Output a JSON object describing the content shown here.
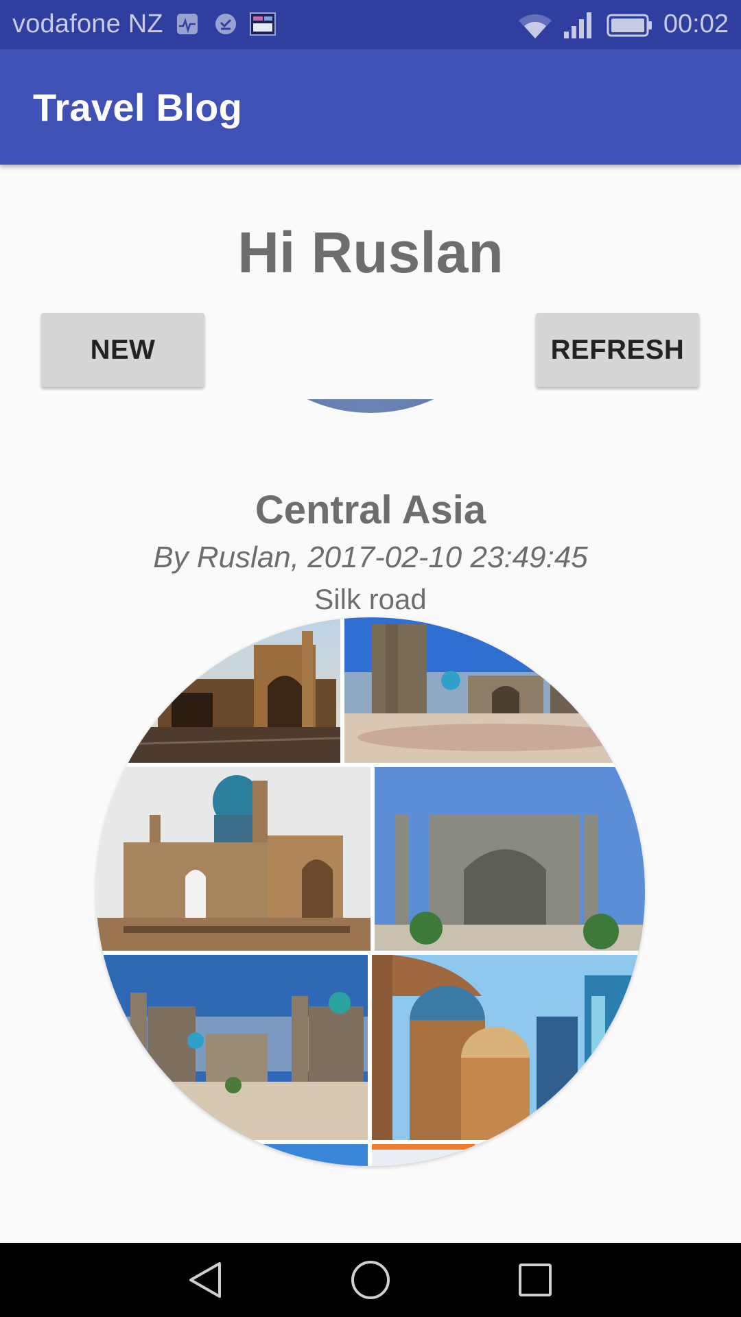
{
  "status_bar": {
    "carrier": "vodafone NZ",
    "time": "00:02",
    "icons": [
      "health-notification-icon",
      "check-notification-icon",
      "image-notification-icon",
      "wifi-icon",
      "signal-icon",
      "battery-icon"
    ]
  },
  "app_bar": {
    "title": "Travel Blog"
  },
  "greeting": "Hi Ruslan",
  "buttons": {
    "new_label": "NEW",
    "refresh_label": "REFRESH"
  },
  "post": {
    "title": "Central Asia",
    "meta": "By Ruslan, 2017-02-10 23:49:45",
    "body": "Silk road",
    "image_description_icon": "photo-collage"
  },
  "nav_bar": {
    "icons": [
      "back-icon",
      "home-icon",
      "recents-icon"
    ]
  },
  "colors": {
    "status_bar": "#303f9f",
    "app_bar": "#3f51b5",
    "background": "#fafafa",
    "button": "#d6d6d6",
    "text_secondary": "#6d6d6d"
  }
}
